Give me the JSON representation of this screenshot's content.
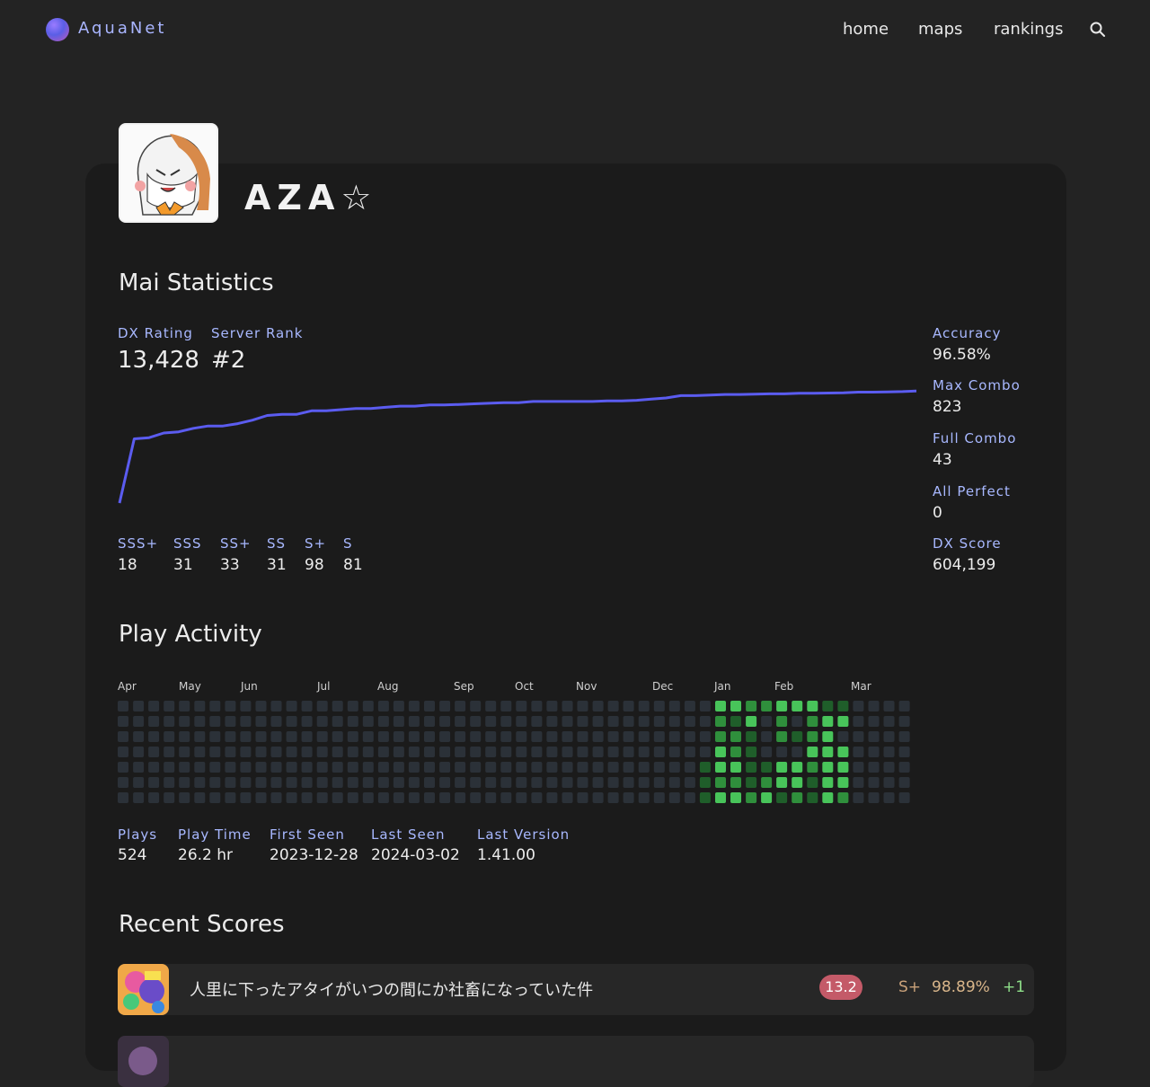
{
  "brand": {
    "name": "AquaNet"
  },
  "nav": {
    "home": "home",
    "maps": "maps",
    "rankings": "rankings",
    "search_icon": "search-icon"
  },
  "profile": {
    "username": "AZA☆"
  },
  "stats": {
    "heading": "Mai Statistics",
    "dx_rating_label": "DX Rating",
    "dx_rating_value": "13,428",
    "server_rank_label": "Server Rank",
    "server_rank_value": "#2",
    "accuracy_label": "Accuracy",
    "accuracy_value": "96.58%",
    "max_combo_label": "Max Combo",
    "max_combo_value": "823",
    "full_combo_label": "Full Combo",
    "full_combo_value": "43",
    "all_perfect_label": "All Perfect",
    "all_perfect_value": "0",
    "dx_score_label": "DX Score",
    "dx_score_value": "604,199",
    "ranks": [
      {
        "label": "SSS+",
        "value": "18"
      },
      {
        "label": "SSS",
        "value": "31"
      },
      {
        "label": "SS+",
        "value": "33"
      },
      {
        "label": "SS",
        "value": "31"
      },
      {
        "label": "S+",
        "value": "98"
      },
      {
        "label": "S",
        "value": "81"
      }
    ]
  },
  "rating_curve": [
    0,
    0.55,
    0.56,
    0.6,
    0.61,
    0.64,
    0.66,
    0.66,
    0.68,
    0.71,
    0.75,
    0.76,
    0.76,
    0.79,
    0.79,
    0.8,
    0.81,
    0.81,
    0.82,
    0.83,
    0.83,
    0.84,
    0.84,
    0.845,
    0.85,
    0.855,
    0.86,
    0.86,
    0.87,
    0.87,
    0.87,
    0.87,
    0.87,
    0.875,
    0.875,
    0.88,
    0.89,
    0.9,
    0.92,
    0.92,
    0.925,
    0.93,
    0.93,
    0.932,
    0.935,
    0.935,
    0.94,
    0.94,
    0.942,
    0.945,
    0.95,
    0.95,
    0.952,
    0.955,
    0.96
  ],
  "activity": {
    "heading": "Play Activity",
    "months": [
      "Apr",
      "May",
      "Jun",
      "Jul",
      "Aug",
      "Sep",
      "Oct",
      "Nov",
      "Dec",
      "Jan",
      "Feb",
      "Mar"
    ],
    "plays_label": "Plays",
    "plays_value": "524",
    "play_time_label": "Play Time",
    "play_time_value": "26.2 hr",
    "first_seen_label": "First Seen",
    "first_seen_value": "2023-12-28",
    "last_seen_label": "Last Seen",
    "last_seen_value": "2024-03-02",
    "last_version_label": "Last Version",
    "last_version_value": "1.41.00",
    "empty_color": "#2b3138",
    "levels": [
      "#2b3138",
      "#1f5e2a",
      "#2f8f3c",
      "#48c45a"
    ]
  },
  "recent": {
    "heading": "Recent Scores",
    "items": [
      {
        "title": "人里に下ったアタイがいつの間にか社畜になっていた件",
        "level": "13.2",
        "rank": "S+",
        "accuracy": "98.89%",
        "delta": "+1"
      }
    ]
  },
  "colors": {
    "accent": "#a8b8ff",
    "curve": "#5b5cf0",
    "badge": "#c45a68"
  }
}
